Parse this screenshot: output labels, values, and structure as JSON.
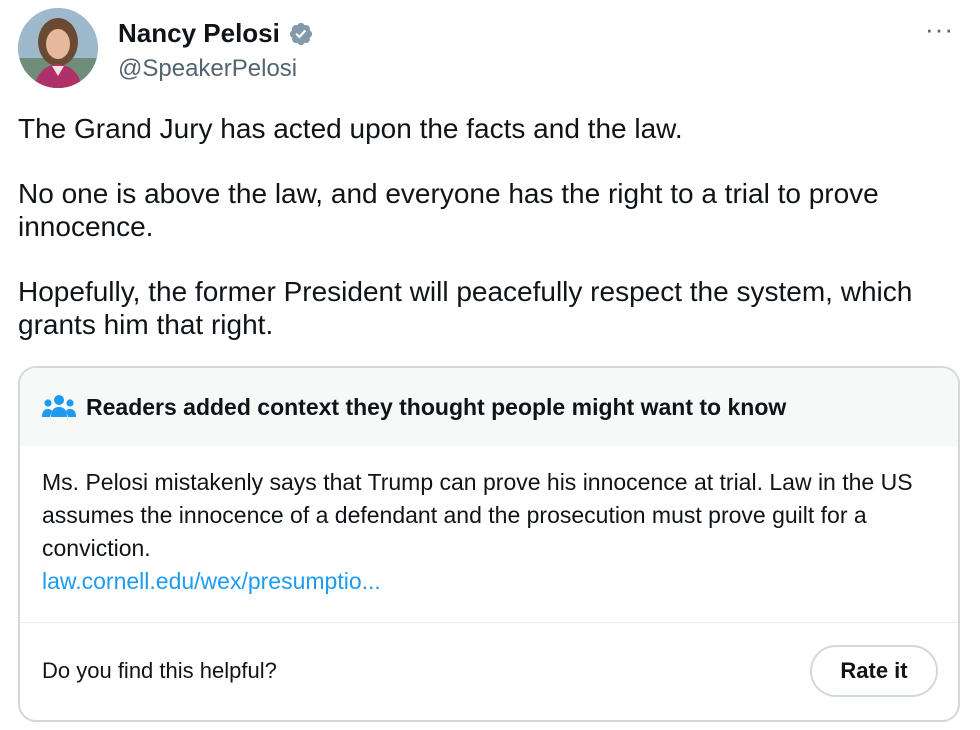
{
  "author": {
    "display_name": "Nancy Pelosi",
    "handle": "@SpeakerPelosi",
    "verified_icon": "verified-badge-icon",
    "more_label": "···"
  },
  "tweet": {
    "paragraphs": [
      "The Grand Jury has acted upon the facts and the law.",
      "No one is above the law, and everyone has the right to a trial to prove innocence.",
      "Hopefully, the former President will peacefully respect the system, which grants him that right."
    ]
  },
  "community_note": {
    "header_icon": "people-icon",
    "title": "Readers added context they thought people might want to know",
    "body": "Ms. Pelosi mistakenly says that Trump can prove his innocence at trial. Law in the US assumes the innocence of a defendant and the prosecution must prove guilt for a conviction.",
    "link_text": "law.cornell.edu/wex/presumptio...",
    "question": "Do you find this helpful?",
    "rate_button": "Rate it"
  },
  "colors": {
    "text": "#0f1419",
    "secondary": "#536471",
    "link": "#1d9bf0",
    "verified": "#829aab",
    "note_header_bg": "#f7f9f9",
    "border": "#cfd9de"
  }
}
